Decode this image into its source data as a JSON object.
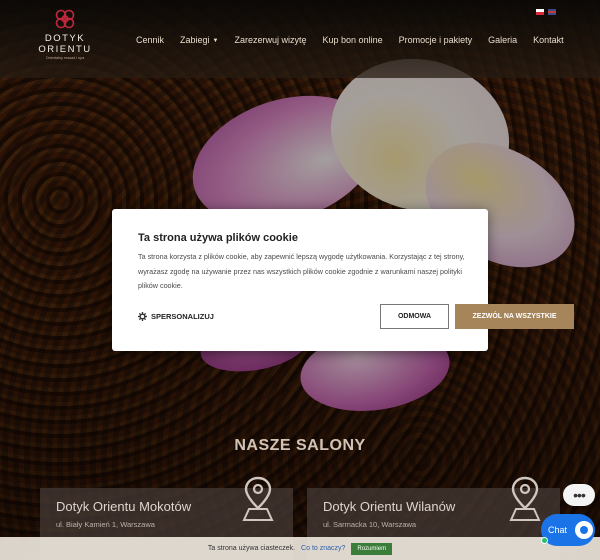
{
  "brand": {
    "name_line1": "DOTYK",
    "name_line2": "ORIENTU",
    "tagline": "Orientalny masaż i spa"
  },
  "nav": {
    "items": [
      "Cennik",
      "Zabiegi",
      "Zarezerwuj wizytę",
      "Kup bon online",
      "Promocje i pakiety",
      "Galeria",
      "Kontakt"
    ],
    "dropdown_index": 1
  },
  "languages": [
    "pl",
    "en"
  ],
  "section": {
    "title": "NASZE SALONY"
  },
  "salons": [
    {
      "name": "Dotyk Orientu Mokotów",
      "address": "ul. Biały Kamień 1, Warszawa"
    },
    {
      "name": "Dotyk Orientu Wilanów",
      "address": "ul. Sarmacka 10, Warszawa"
    }
  ],
  "cookie_modal": {
    "title": "Ta strona używa plików cookie",
    "text": "Ta strona korzysta z plików cookie, aby zapewnić lepszą wygodę użytkowania. Korzystając z tej strony, wyrażasz zgodę na używanie przez nas wszystkich plików cookie zgodnie z warunkami naszej polityki plików cookie.",
    "personalize_label": "SPERSONALIZUJ",
    "decline_label": "ODMOWA",
    "accept_label": "ZEZWÓL NA WSZYSTKIE"
  },
  "cookie_bar": {
    "text": "Ta strona używa ciasteczek.",
    "link": "Co to znaczy?",
    "button": "Rozumiem"
  },
  "chat": {
    "label": "Chat"
  },
  "colors": {
    "accent": "#a7855b",
    "chat_blue": "#1a74e8",
    "logo_red": "#c0283c",
    "cookie_bar_button": "#3b7e3a"
  }
}
